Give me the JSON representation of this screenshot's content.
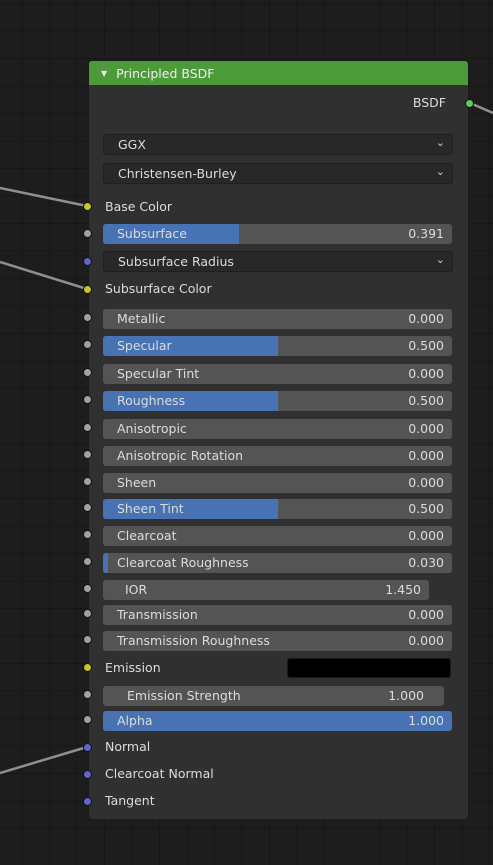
{
  "node": {
    "title": "Principled BSDF",
    "output": "BSDF",
    "distribution": "GGX",
    "subsurface_method": "Christensen-Burley"
  },
  "inputs": {
    "base_color": "Base Color",
    "subsurface": {
      "label": "Subsurface",
      "value": "0.391",
      "fraction": 0.391
    },
    "subsurface_radius": "Subsurface Radius",
    "subsurface_color": "Subsurface Color",
    "metallic": {
      "label": "Metallic",
      "value": "0.000",
      "fraction": 0
    },
    "specular": {
      "label": "Specular",
      "value": "0.500",
      "fraction": 0.5
    },
    "specular_tint": {
      "label": "Specular Tint",
      "value": "0.000",
      "fraction": 0
    },
    "roughness": {
      "label": "Roughness",
      "value": "0.500",
      "fraction": 0.5
    },
    "anisotropic": {
      "label": "Anisotropic",
      "value": "0.000",
      "fraction": 0
    },
    "anisotropic_rotation": {
      "label": "Anisotropic Rotation",
      "value": "0.000",
      "fraction": 0
    },
    "sheen": {
      "label": "Sheen",
      "value": "0.000",
      "fraction": 0
    },
    "sheen_tint": {
      "label": "Sheen Tint",
      "value": "0.500",
      "fraction": 0.5
    },
    "clearcoat": {
      "label": "Clearcoat",
      "value": "0.000",
      "fraction": 0
    },
    "clearcoat_roughness": {
      "label": "Clearcoat Roughness",
      "value": "0.030",
      "fraction": 0.03
    },
    "ior": {
      "label": "IOR",
      "value": "1.450"
    },
    "transmission": {
      "label": "Transmission",
      "value": "0.000",
      "fraction": 0
    },
    "transmission_roughness": {
      "label": "Transmission Roughness",
      "value": "0.000",
      "fraction": 0
    },
    "emission": {
      "label": "Emission",
      "color": "#000000"
    },
    "emission_strength": {
      "label": "Emission Strength",
      "value": "1.000"
    },
    "alpha": {
      "label": "Alpha",
      "value": "1.000",
      "fraction": 1
    },
    "normal": "Normal",
    "clearcoat_normal": "Clearcoat Normal",
    "tangent": "Tangent"
  },
  "colors": {
    "header": "#4c9a3a",
    "slider_fill": "#4772b3",
    "socket_grey": "#a1a1a1",
    "socket_yellow": "#c7c729",
    "socket_blue": "#6363c7",
    "socket_green": "#63c763"
  },
  "icons": {
    "collapse": "triangle-down-icon",
    "dropdown": "chevron-down-icon"
  }
}
